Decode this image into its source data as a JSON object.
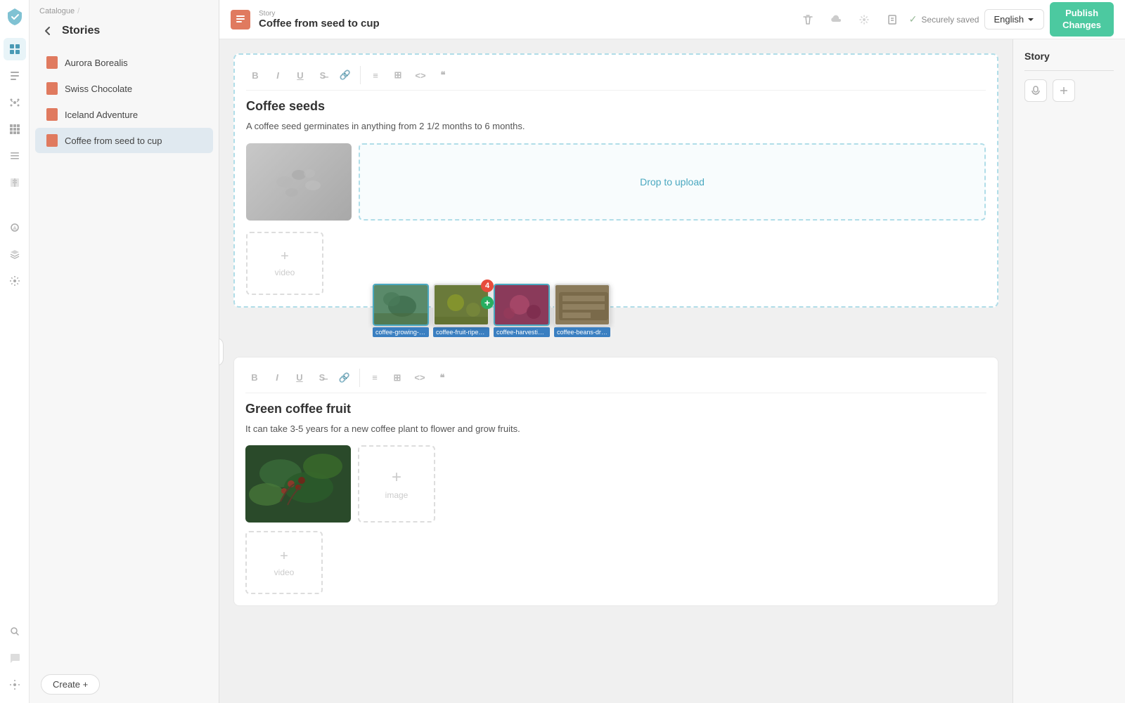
{
  "app": {
    "logo_alt": "App Logo"
  },
  "sidebar": {
    "breadcrumb": "Catalogue",
    "title": "Stories",
    "items": [
      {
        "id": "aurora",
        "label": "Aurora Borealis",
        "active": false
      },
      {
        "id": "swiss",
        "label": "Swiss Chocolate",
        "active": false
      },
      {
        "id": "iceland",
        "label": "Iceland Adventure",
        "active": false
      },
      {
        "id": "coffee",
        "label": "Coffee from seed to cup",
        "active": true
      }
    ],
    "create_button": "Create +"
  },
  "topbar": {
    "story_label": "Story",
    "story_title": "Coffee from seed to cup",
    "saved_status": "Securely saved",
    "language": "English",
    "publish_line1": "Publish",
    "publish_line2": "Changes"
  },
  "story_panel": {
    "title": "Story"
  },
  "block1": {
    "title": "Coffee seeds",
    "description": "A coffee seed germinates in anything from 2 1/2 months to 6 months.",
    "drop_zone": "Drop to upload",
    "toolbar_items": [
      "B",
      "I",
      "U",
      "🔗",
      "|",
      "≡",
      "⊞",
      "<>",
      "\"\""
    ]
  },
  "block2": {
    "title": "Green coffee fruit",
    "description": "It can take 3-5 years for a new coffee plant to flower and grow fruits.",
    "image_placeholder": "image",
    "video_placeholder": "video",
    "toolbar_items": [
      "B",
      "I",
      "U",
      "🔗",
      "|",
      "≡",
      "⊞",
      "<>",
      "\"\""
    ]
  },
  "thumbnails": [
    {
      "filename": "coffee-growing-twice-a-...vest.jpg",
      "selected": true
    },
    {
      "filename": "coffee-fruit-ripening.jpg",
      "has_plus": true,
      "has_badge": true,
      "badge_count": 4
    },
    {
      "filename": "coffee-harvesting.jpg",
      "selected": true
    },
    {
      "filename": "coffee-beans-drying.jpg"
    }
  ]
}
